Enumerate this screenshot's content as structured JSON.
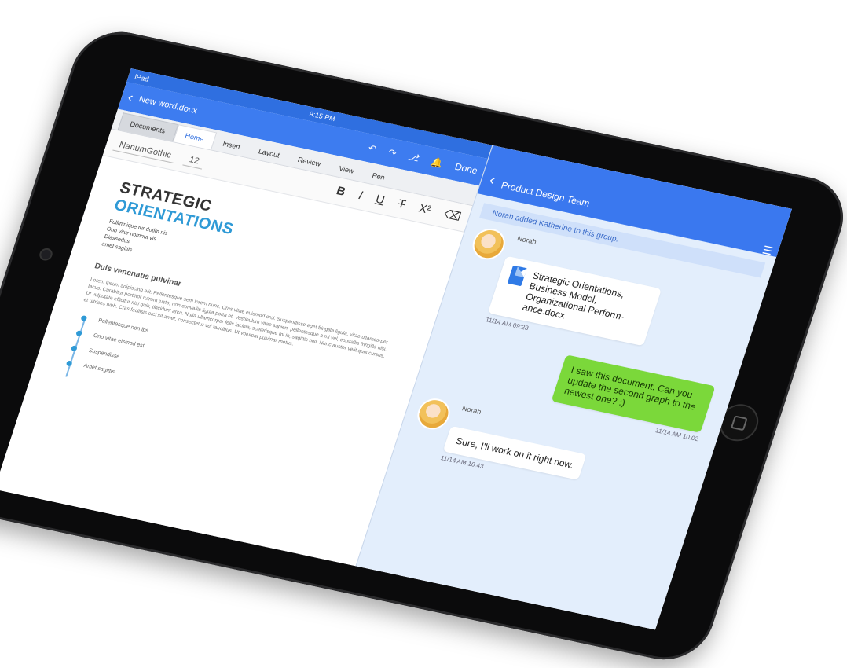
{
  "status": {
    "carrier": "iPad",
    "time": "9:15 PM"
  },
  "document": {
    "title": "New word.docx",
    "tabs": [
      "Documents",
      "Home",
      "Insert",
      "Layout",
      "Review",
      "View",
      "Pen"
    ],
    "font": "NanumGothic",
    "size": "12",
    "done": "Done",
    "heading1": "STRATEGIC",
    "heading2": "ORIENTATIONS",
    "sub_lines": [
      "Fullminique tur dotim nis",
      "Ono vitur nomnut vis",
      "Diassedus",
      "amet sagittis"
    ],
    "section": "Duis venenatis pulvinar",
    "paragraph": "Lorem ipsum adipiscing elit. Pellentesque sem lorem nunc. Cras vitae euismod orci. Suspendisse eget fringilla ligula, vitae ullamcorper lacus. Curabitur porttitor rutrum justo, non convallis ligula porta et. Vestibulum vitae sapien, pellentesque a mi vel, convallis fringilla nisi. Ut vulputate efficitur nisi quis, tincidunt arcu. Nulla ullamcorper felis lacinia, scelerisque mi in, sagittis nisi. Nunc auctor velit quis cursus, et ultrices nibh. Cras facilisis orci sit amet, consectetur vel faucibus. Ut volutpat pulvinar metus.",
    "timeline": [
      "Pellentesque non ips",
      "Ono vitae eismod est",
      "Suspendisse",
      "Amet sagittis"
    ]
  },
  "chat": {
    "title": "Product Design Team",
    "notice": "Norah added Katherine to this group.",
    "messages": [
      {
        "sender": "Norah",
        "text": "Strategic Orientations, Business Model, Organizational Perform-ance.docx",
        "time": "11/14 AM 09:23"
      },
      {
        "sender": "",
        "text": "I saw this document. Can you update the second graph to the newest one? :)",
        "time": "11/14 AM 10:02"
      },
      {
        "sender": "Norah",
        "text": "Sure, I'll work on it right now.",
        "time": "11/14 AM 10:43"
      }
    ]
  },
  "colors": {
    "accent": "#3a78ef",
    "document_heading": "#2f9ad6",
    "green_bubble": "#7bd83a"
  }
}
